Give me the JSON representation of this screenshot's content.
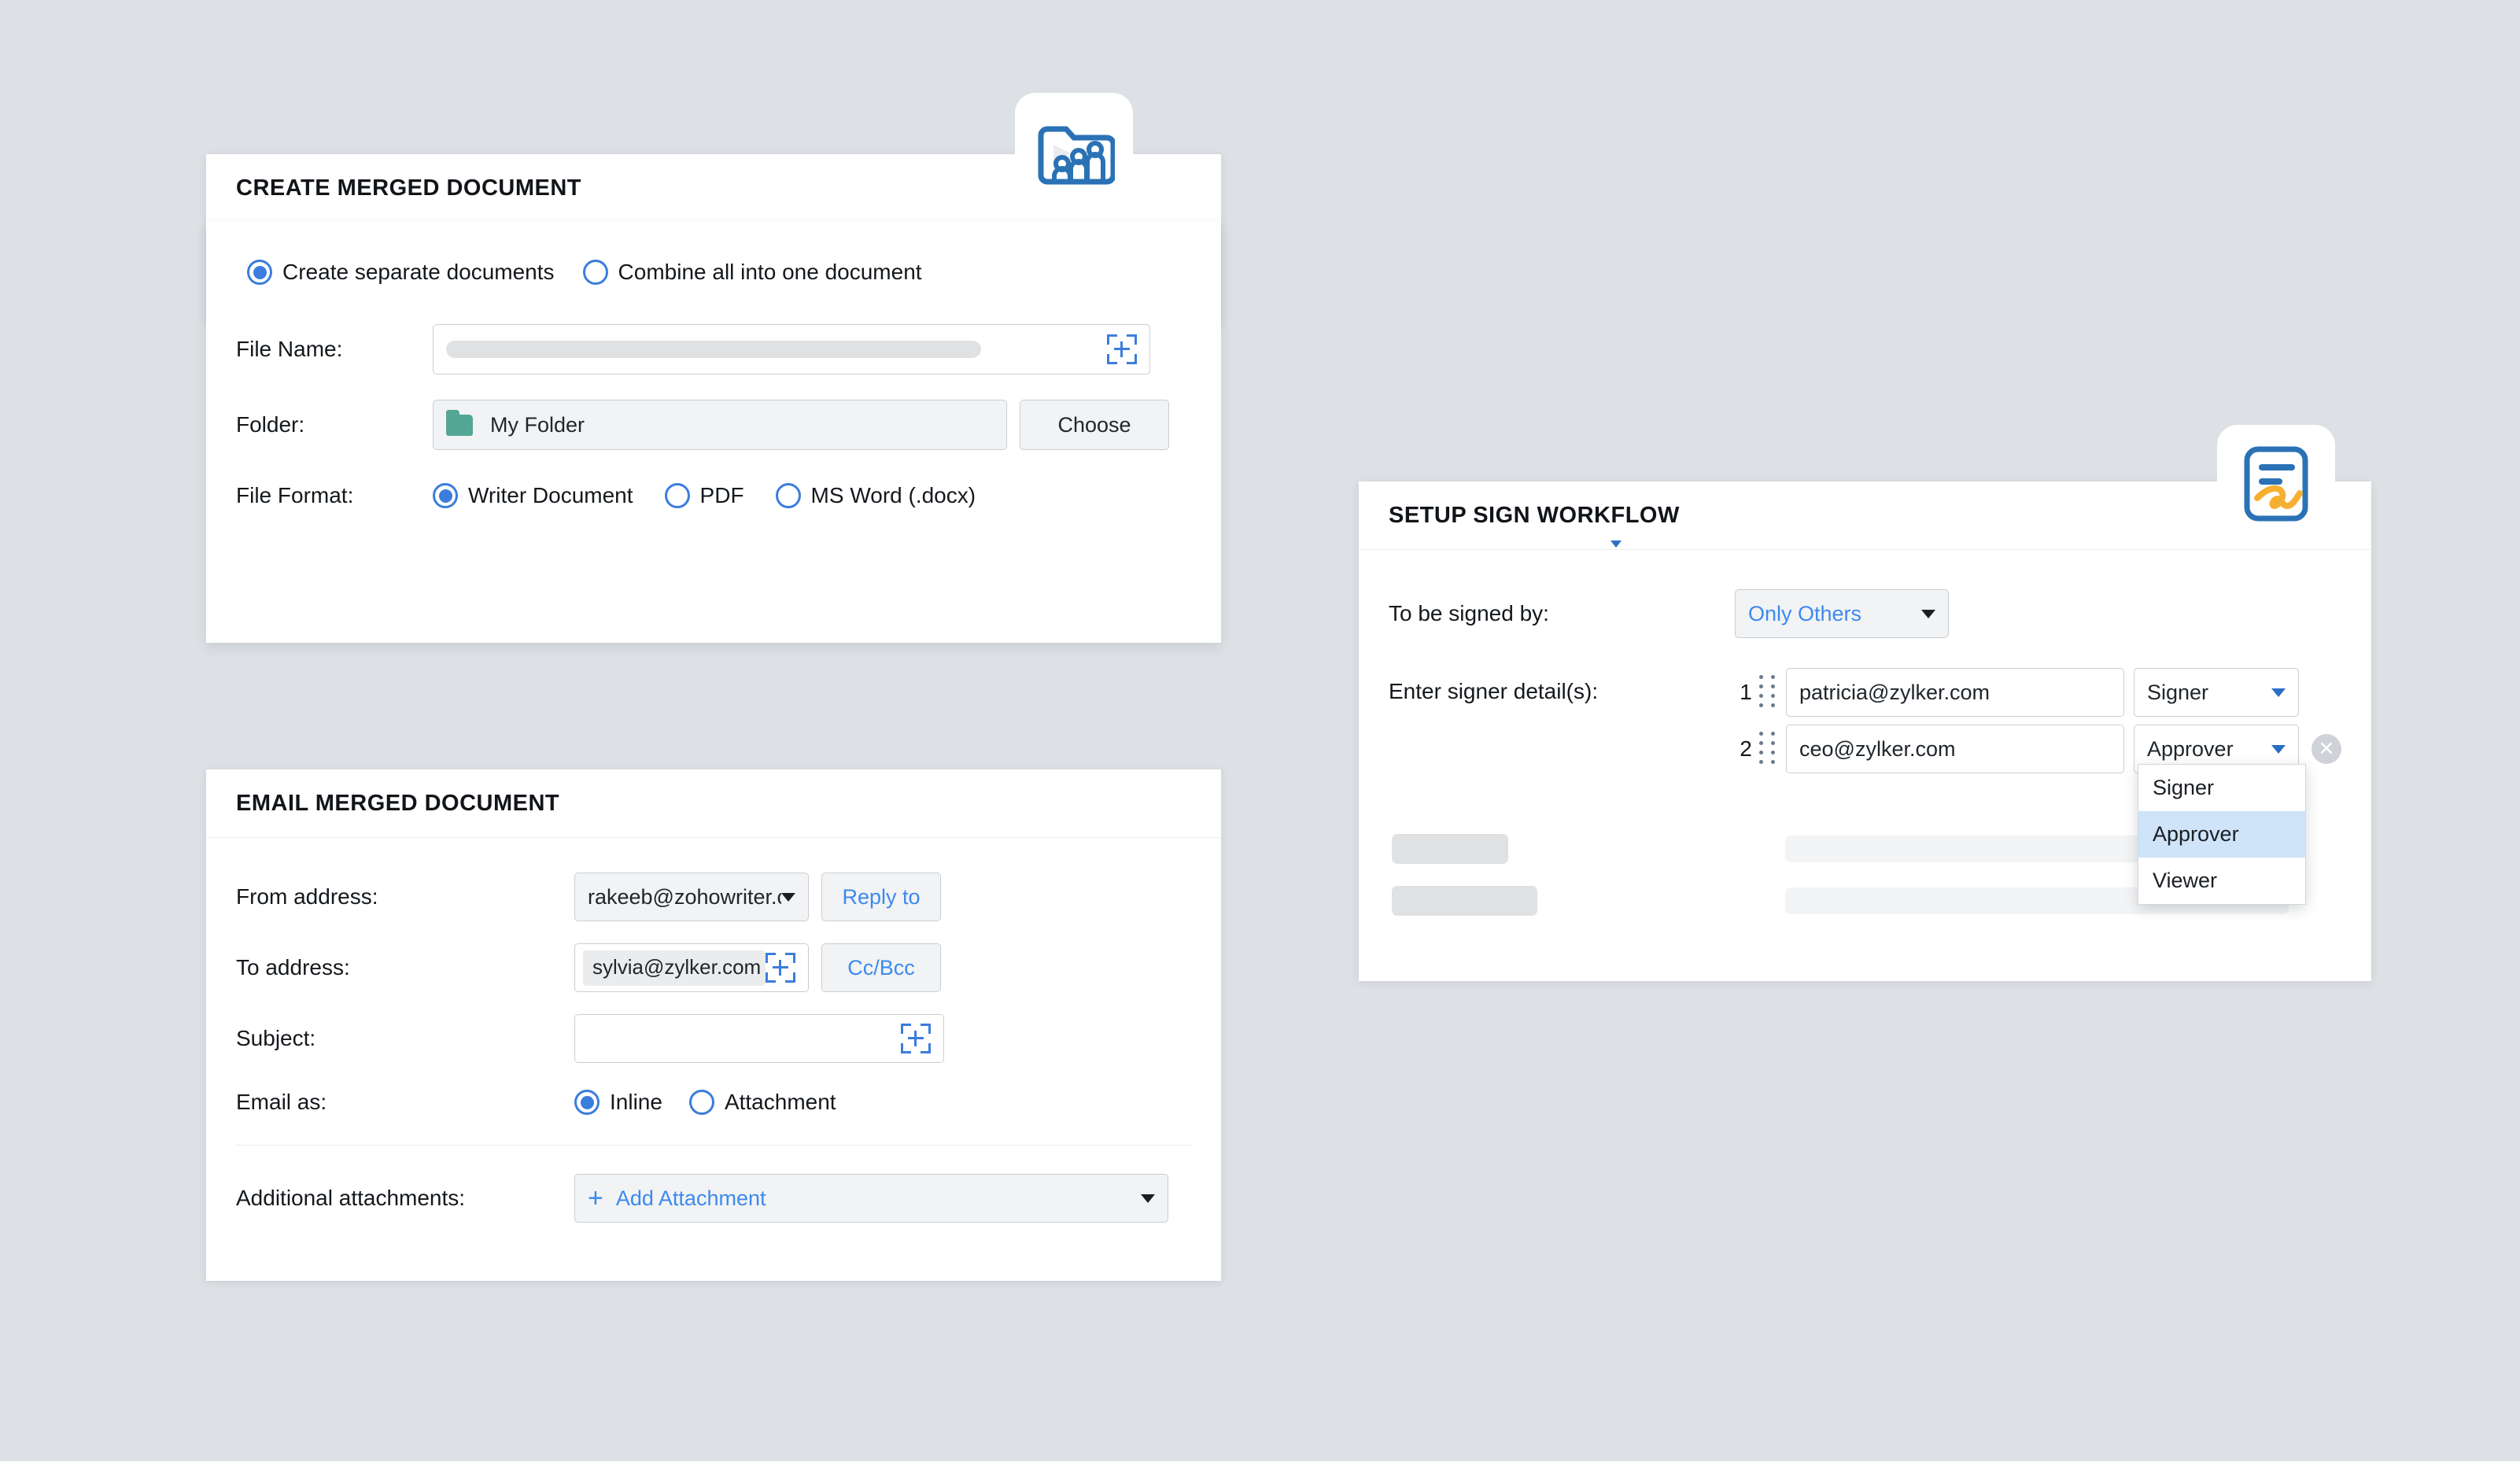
{
  "theme": {
    "page_bg": "#dde0e4",
    "panel_bg": "#ffffff",
    "accent_blue": "#3b7ddd",
    "link_blue": "#3b8aef",
    "folder_green": "#54a695",
    "signature_orange": "#f6b030",
    "menu_highlight": "#cfe3f9"
  },
  "merge_panel": {
    "title": "CREATE MERGED DOCUMENT",
    "badge_icon": "folder-with-people-icon",
    "mode_options": [
      {
        "label": "Create separate documents",
        "selected": true
      },
      {
        "label": "Combine all into one document",
        "selected": false
      }
    ],
    "file_name": {
      "label": "File Name:",
      "value": "",
      "placeholder": "",
      "merge_field_icon": "insert-merge-field-icon"
    },
    "folder": {
      "label": "Folder:",
      "value": "My Folder",
      "icon": "folder-icon",
      "choose_label": "Choose"
    },
    "file_format": {
      "label": "File Format:",
      "options": [
        {
          "label": "Writer Document",
          "selected": true
        },
        {
          "label": "PDF",
          "selected": false
        },
        {
          "label": "MS Word (.docx)",
          "selected": false
        }
      ]
    }
  },
  "email_panel": {
    "title": "EMAIL MERGED DOCUMENT",
    "from": {
      "label": "From address:",
      "value": "rakeeb@zohowriter.com",
      "chevron_icon": "chevron-down-icon",
      "reply_to_label": "Reply to"
    },
    "to": {
      "label": "To address:",
      "chips": [
        {
          "text": "sylvia@zylker.com",
          "remove_icon": "close-icon"
        }
      ],
      "merge_field_icon": "insert-merge-field-icon",
      "cc_bcc_label": "Cc/Bcc"
    },
    "subject": {
      "label": "Subject:",
      "value": "",
      "merge_field_icon": "insert-merge-field-icon"
    },
    "email_as": {
      "label": "Email as:",
      "options": [
        {
          "label": "Inline",
          "selected": true
        },
        {
          "label": "Attachment",
          "selected": false
        }
      ]
    },
    "additional_attachments": {
      "label": "Additional attachments:",
      "action_label": "Add Attachment",
      "plus_icon": "plus-icon",
      "chevron_icon": "chevron-down-icon"
    }
  },
  "sign_panel": {
    "title": "SETUP SIGN WORKFLOW",
    "badge_icon": "document-signature-icon",
    "signed_by": {
      "label": "To be signed by:",
      "value": "Only Others",
      "chevron_icon": "chevron-down-icon"
    },
    "signers": {
      "label": "Enter signer detail(s):",
      "rows": [
        {
          "index": "1",
          "email": "patricia@zylker.com",
          "role": "Signer",
          "drag_icon": "drag-handle-icon",
          "chevron_icon": "chevron-down-icon",
          "has_remove": false
        },
        {
          "index": "2",
          "email": "ceo@zylker.com",
          "role": "Approver",
          "drag_icon": "drag-handle-icon",
          "chevron_icon": "chevron-down-icon",
          "has_remove": true,
          "remove_icon": "close-icon"
        }
      ]
    },
    "role_menu": {
      "open": true,
      "options": [
        {
          "label": "Signer",
          "selected": false
        },
        {
          "label": "Approver",
          "selected": true
        },
        {
          "label": "Viewer",
          "selected": false
        }
      ]
    },
    "skeleton_rows": 2
  }
}
